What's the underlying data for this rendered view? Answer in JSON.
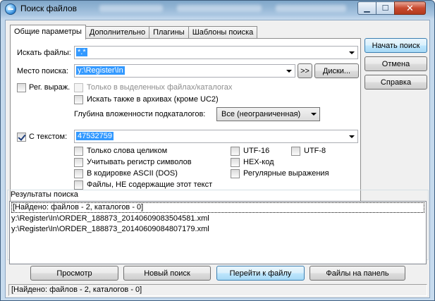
{
  "window": {
    "title": "Поиск файлов"
  },
  "tabs": [
    {
      "label": "Общие параметры"
    },
    {
      "label": "Дополнительно"
    },
    {
      "label": "Плагины"
    },
    {
      "label": "Шаблоны поиска"
    }
  ],
  "search": {
    "files_label": "Искать файлы:",
    "files_value": "*.*",
    "location_label": "Место поиска:",
    "location_value": "y:\\Register\\In",
    "arrows_label": ">>",
    "drives_label": "Диски...",
    "regex_label": "Рег. выраж.",
    "only_selected_label": "Только в выделенных файлах/каталогах",
    "archives_label": "Искать также в архивах (кроме UC2)",
    "depth_label": "Глубина вложенности подкаталогов:",
    "depth_value": "Все (неограниченная)",
    "text_label": "С текстом:",
    "text_value": "47532759"
  },
  "options": {
    "whole_words": "Только слова целиком",
    "case": "Учитывать регистр символов",
    "ascii": "В кодировке ASCII (DOS)",
    "not_contain": "Файлы, НЕ содержащие этот текст",
    "utf16": "UTF-16",
    "utf8": "UTF-8",
    "hex": "HEX-код",
    "regex": "Регулярные выражения"
  },
  "buttons": {
    "start": "Начать поиск",
    "cancel": "Отмена",
    "help": "Справка",
    "view": "Просмотр",
    "new_search": "Новый поиск",
    "goto_file": "Перейти к файлу",
    "to_panel": "Файлы на панель"
  },
  "results": {
    "label": "Результаты поиска",
    "rows": [
      "[Найдено: файлов - 2, каталогов - 0]",
      "y:\\Register\\In\\ORDER_188873_20140609083504581.xml",
      "y:\\Register\\In\\ORDER_188873_20140609084807179.xml"
    ]
  },
  "status": {
    "text": "[Найдено: файлов - 2, каталогов - 0]"
  }
}
